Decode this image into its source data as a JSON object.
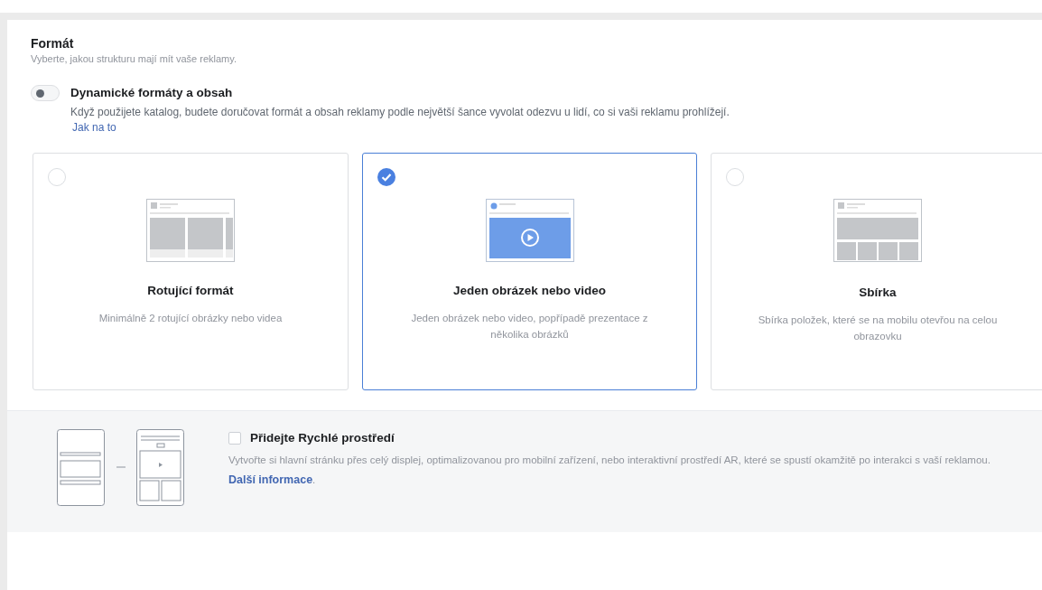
{
  "section": {
    "title": "Formát",
    "subtitle": "Vyberte, jakou strukturu mají mít vaše reklamy."
  },
  "dynamic": {
    "on": false,
    "title": "Dynamické formáty a obsah",
    "description": "Když použijete katalog, budete doručovat formát a obsah reklamy podle největší šance vyvolat odezvu u lidí, co si vaši reklamu prohlížejí.",
    "link": "Jak na to"
  },
  "formats": [
    {
      "kind": "carousel",
      "selected": false,
      "title": "Rotující formát",
      "description": "Minimálně 2 rotující obrázky nebo videa"
    },
    {
      "kind": "single",
      "selected": true,
      "title": "Jeden obrázek nebo video",
      "description": "Jeden obrázek nebo video, popřípadě prezentace z několika obrázků"
    },
    {
      "kind": "collection",
      "selected": false,
      "title": "Sbírka",
      "description": "Sbírka položek, které se na mobilu otevřou na celou obrazovku"
    }
  ],
  "instant": {
    "checked": false,
    "title": "Přidejte Rychlé prostředí",
    "description": "Vytvořte si hlavní stránku přes celý displej, optimalizovanou pro mobilní zařízení, nebo interaktivní prostředí AR, které se spustí okamžitě po interakci s vaší reklamou.",
    "link": "Další informace",
    "after_link": "."
  }
}
